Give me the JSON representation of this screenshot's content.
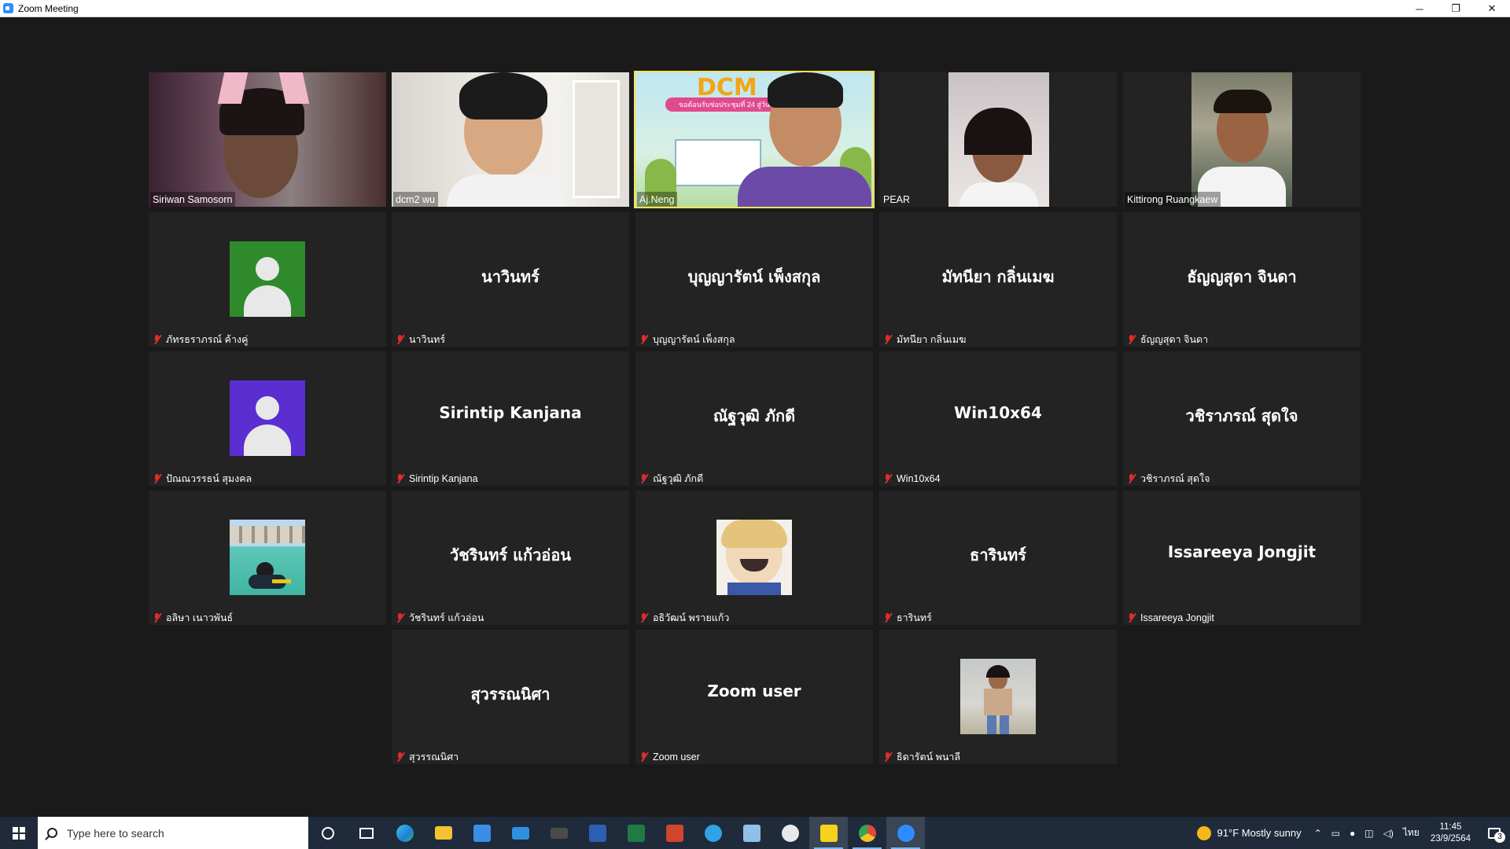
{
  "window": {
    "title": "Zoom Meeting",
    "minimize": "─",
    "restore": "❐",
    "close": "✕"
  },
  "tiles": [
    {
      "name": "Siriwan Samosorn"
    },
    {
      "name": "dcm2 wu"
    },
    {
      "name": "Aj.Neng"
    },
    {
      "name": "PEAR"
    },
    {
      "name": "Kittirong Ruangkaew"
    },
    {
      "name": "ภัทรธราภรณ์ ค้างคู่"
    },
    {
      "big": "นาวินทร์",
      "name": "นาวินทร์"
    },
    {
      "big": "บุญญารัตน์ เพ็งสกุล",
      "name": "บุญญารัตน์ เพ็งสกุล"
    },
    {
      "big": "มัทนียา กลิ่นเมฆ",
      "name": "มัทนียา กลิ่นเมฆ"
    },
    {
      "big": "ธัญญสุดา จินดา",
      "name": "ธัญญสุดา จินดา"
    },
    {
      "name": "ปัณณวรรธน์ สุมงคล"
    },
    {
      "big": "Sirintip Kanjana",
      "name": "Sirintip Kanjana"
    },
    {
      "big": "ณัฐวุฒิ ภักดี",
      "name": "ณัฐวุฒิ ภักดี"
    },
    {
      "big": "Win10x64",
      "name": "Win10x64"
    },
    {
      "big": "วชิราภรณ์ สุดใจ",
      "name": "วชิราภรณ์ สุดใจ"
    },
    {
      "name": "อลิษา เนาวพันธ์"
    },
    {
      "big": "วัชรินทร์ แก้วอ่อน",
      "name": "วัชรินทร์ แก้วอ่อน"
    },
    {
      "name": "อธิวัฒน์ พรายแก้ว"
    },
    {
      "big": "ธารินทร์",
      "name": "ธารินทร์"
    },
    {
      "big": "Issareeya Jongjit",
      "name": "Issareeya Jongjit"
    },
    {
      "big": "สุวรรณนิศา",
      "name": "สุวรรณนิศา"
    },
    {
      "big": "Zoom user",
      "name": "Zoom user"
    },
    {
      "name": "ธิดารัตน์ พนาลี"
    }
  ],
  "video_banner": {
    "text": "DCM",
    "sub": "ขอต้อนรับช่อประชุมที่ 24 สู่วัน"
  },
  "taskbar": {
    "search_placeholder": "Type here to search",
    "weather": "91°F  Mostly sunny",
    "lang": "ไทย",
    "time": "11:45",
    "date": "23/9/2564",
    "notifications": "3"
  }
}
